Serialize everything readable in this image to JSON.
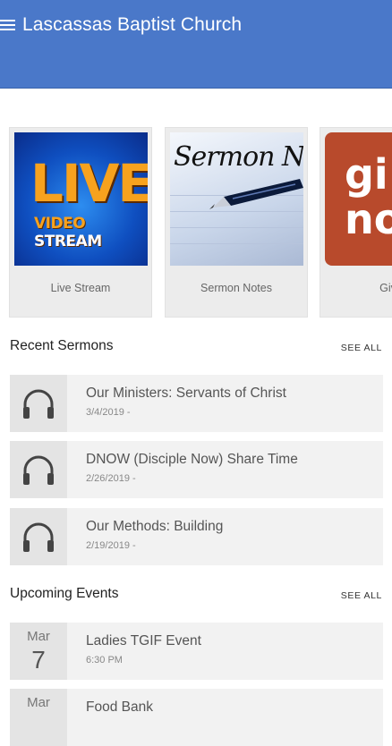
{
  "header": {
    "title": "Lascassas Baptist Church",
    "menu_icon": "hamburger-menu-icon"
  },
  "cards": [
    {
      "label": "Live Stream",
      "image_text_main": "LIVE",
      "image_text_sub_1": "VIDEO ",
      "image_text_sub_2": "STREAM"
    },
    {
      "label": "Sermon Notes",
      "image_text_main": "Sermon Notes"
    },
    {
      "label": "Give",
      "image_text_main": "gi",
      "image_text_sub": "no"
    }
  ],
  "recent_sermons": {
    "title": "Recent Sermons",
    "see_all": "SEE ALL",
    "items": [
      {
        "title": "Our Ministers: Servants of Christ",
        "subtitle": "3/4/2019 -",
        "icon": "headphones-icon"
      },
      {
        "title": "DNOW (Disciple Now) Share Time",
        "subtitle": "2/26/2019 -",
        "icon": "headphones-icon"
      },
      {
        "title": "Our Methods: Building",
        "subtitle": "2/19/2019 -",
        "icon": "headphones-icon"
      }
    ]
  },
  "upcoming_events": {
    "title": "Upcoming Events",
    "see_all": "SEE ALL",
    "items": [
      {
        "month": "Mar",
        "day": "7",
        "title": "Ladies TGIF Event",
        "subtitle": "6:30 PM"
      },
      {
        "month": "Mar",
        "day": "",
        "title": "Food Bank",
        "subtitle": ""
      }
    ]
  },
  "colors": {
    "header": "#4a78c9",
    "card_bg": "#ececec",
    "row_bg": "#f2f2f2"
  }
}
